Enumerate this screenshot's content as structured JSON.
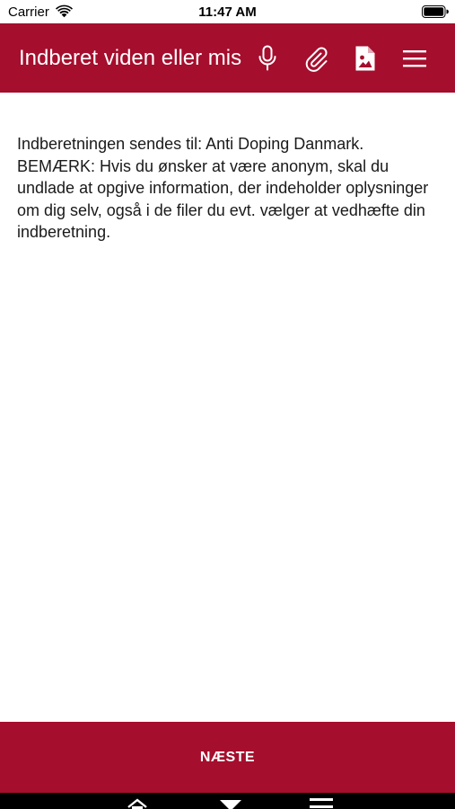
{
  "status_bar": {
    "carrier": "Carrier",
    "time": "11:47 AM"
  },
  "header": {
    "title": "Indberet viden eller mis",
    "background_color": "#a50e2d",
    "icons": [
      "microphone-icon",
      "paperclip-icon",
      "image-file-icon",
      "hamburger-menu-icon"
    ]
  },
  "content": {
    "info_text": "Indberetningen sendes til: Anti Doping Danmark. BEMÆRK: Hvis du ønsker at være anonym, skal du undlade at opgive information, der indeholder oplysninger om dig selv, også i de filer du evt. vælger at vedhæfte din indberetning."
  },
  "footer": {
    "next_label": "NÆSTE",
    "button_color": "#a50e2d"
  },
  "nav_bar": {
    "icons": [
      "home-icon",
      "recent-apps-icon",
      "menu-icon"
    ]
  }
}
